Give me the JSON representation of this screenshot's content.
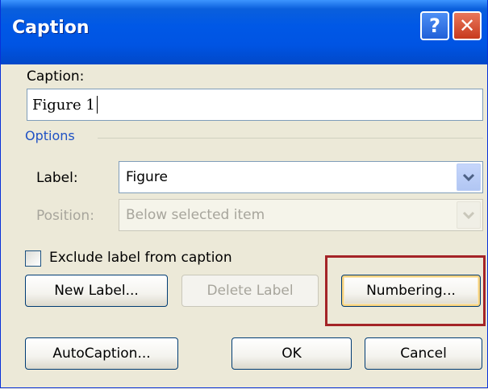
{
  "window": {
    "title": "Caption",
    "help_glyph": "?",
    "close_glyph": "✕"
  },
  "caption": {
    "label": "Caption:",
    "value": "Figure 1"
  },
  "options": {
    "title": "Options",
    "label_label": "Label:",
    "label_value": "Figure",
    "position_label": "Position:",
    "position_value": "Below selected item"
  },
  "exclude_label": {
    "text": "Exclude label from caption",
    "checked": false
  },
  "buttons": {
    "new_label": "New Label...",
    "delete_label": "Delete Label",
    "numbering": "Numbering...",
    "autocaption": "AutoCaption...",
    "ok": "OK",
    "cancel": "Cancel"
  },
  "colors": {
    "titlebar": "#0054e3",
    "annotation_box": "#a42427",
    "options_heading": "#1f51c4"
  }
}
